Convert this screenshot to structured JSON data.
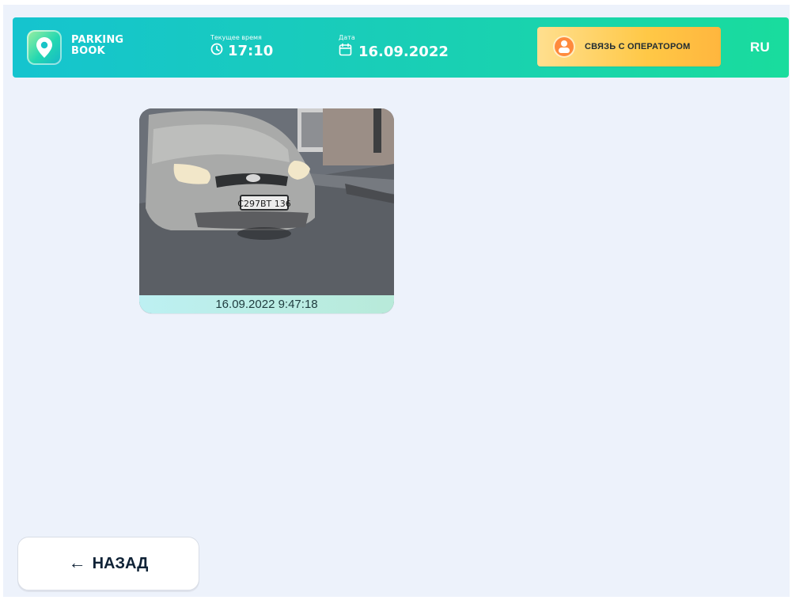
{
  "header": {
    "brand_line1": "PARKING",
    "brand_line2": "BOOK",
    "time_label": "Текущее время",
    "time_value": "17:10",
    "date_label": "Дата",
    "date_value": "16.09.2022",
    "operator_button_label": "СВЯЗЬ С ОПЕРАТОРОМ",
    "language": "RU",
    "colors": {
      "gradient_start": "#15c4cf",
      "gradient_end": "#19dc9d",
      "operator_button": "#ffc846"
    },
    "icons": {
      "logo": "parking-pin-icon",
      "time": "clock-icon",
      "date": "calendar-icon",
      "operator": "operator-avatar-icon"
    }
  },
  "photos": [
    {
      "timestamp": "16.09.2022 9:47:18",
      "plate": "С297ВТ 136"
    }
  ],
  "footer": {
    "back_label": "НАЗАД",
    "back_icon": "arrow-left-icon"
  }
}
